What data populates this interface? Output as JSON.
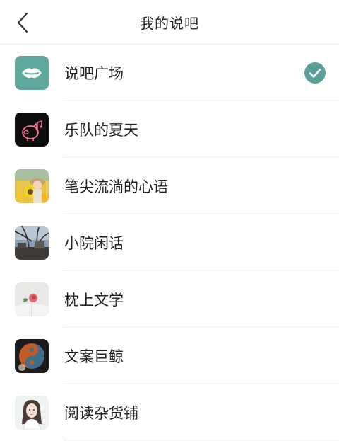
{
  "header": {
    "title": "我的说吧",
    "back_icon": "chevron-left-icon"
  },
  "items": [
    {
      "label": "说吧广场",
      "selected": true,
      "icon": "lips-icon"
    },
    {
      "label": "乐队的夏天",
      "selected": false,
      "icon": "pig-logo-icon"
    },
    {
      "label": "笔尖流淌的心语",
      "selected": false,
      "icon": "sunflower-photo"
    },
    {
      "label": "小院闲话",
      "selected": false,
      "icon": "courtyard-photo"
    },
    {
      "label": "枕上文学",
      "selected": false,
      "icon": "rose-book-photo"
    },
    {
      "label": "文案巨鲸",
      "selected": false,
      "icon": "yin-yang-photo"
    },
    {
      "label": "阅读杂货铺",
      "selected": false,
      "icon": "girl-illustration"
    }
  ],
  "colors": {
    "accent": "#5fa89c",
    "check_bg": "#5a9f95"
  }
}
